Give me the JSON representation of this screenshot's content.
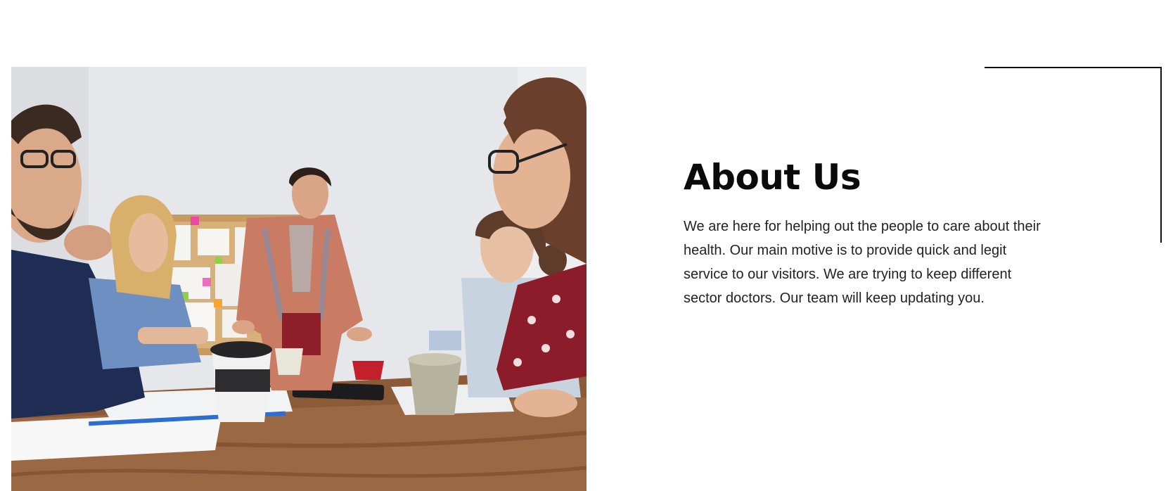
{
  "about": {
    "title": "About Us",
    "body": "We are here for helping out the people to care about their health. Our main motive is to provide quick and legit service to our visitors. We are trying to keep different sector doctors. Our team will keep updating you."
  },
  "colors": {
    "background": "#ffffff",
    "heading": "#0a0a0a",
    "body_text": "#222222",
    "frame_line": "#111111"
  },
  "image": {
    "description_icon": "team-meeting-photo"
  }
}
